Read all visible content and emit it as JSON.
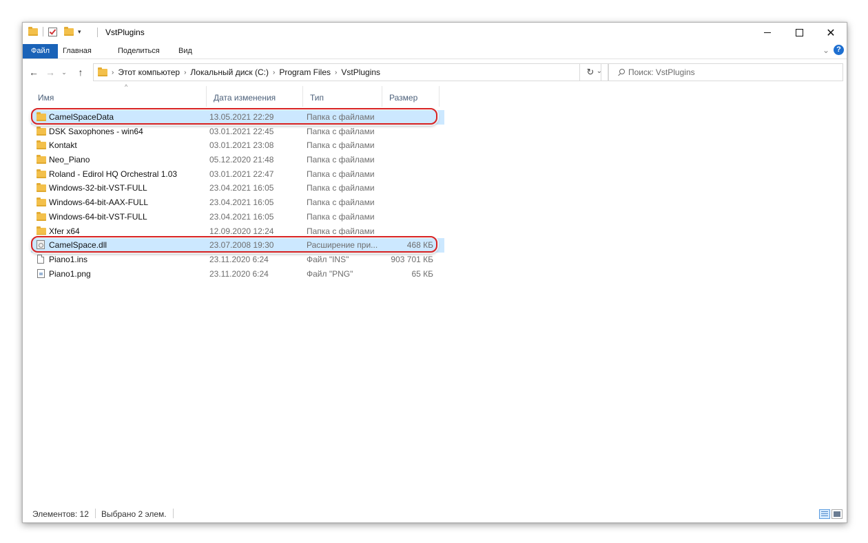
{
  "window": {
    "title": "VstPlugins"
  },
  "ribbon": {
    "tabs": [
      "Файл",
      "Главная",
      "Поделиться",
      "Вид"
    ]
  },
  "address": {
    "crumbs": [
      "Этот компьютер",
      "Локальный диск (C:)",
      "Program Files",
      "VstPlugins"
    ],
    "search_placeholder": "Поиск: VstPlugins"
  },
  "columns": {
    "name": "Имя",
    "date": "Дата изменения",
    "type": "Тип",
    "size": "Размер"
  },
  "files": [
    {
      "name": "CamelSpaceData",
      "date": "13.05.2021 22:29",
      "type": "Папка с файлами",
      "size": "",
      "icon": "folder-icon",
      "selected": true
    },
    {
      "name": "DSK Saxophones - win64",
      "date": "03.01.2021 22:45",
      "type": "Папка с файлами",
      "size": "",
      "icon": "folder-icon",
      "selected": false
    },
    {
      "name": "Kontakt",
      "date": "03.01.2021 23:08",
      "type": "Папка с файлами",
      "size": "",
      "icon": "folder-icon",
      "selected": false
    },
    {
      "name": "Neo_Piano",
      "date": "05.12.2020 21:48",
      "type": "Папка с файлами",
      "size": "",
      "icon": "folder-icon",
      "selected": false
    },
    {
      "name": "Roland - Edirol HQ Orchestral 1.03",
      "date": "03.01.2021 22:47",
      "type": "Папка с файлами",
      "size": "",
      "icon": "folder-icon",
      "selected": false
    },
    {
      "name": "Windows-32-bit-VST-FULL",
      "date": "23.04.2021 16:05",
      "type": "Папка с файлами",
      "size": "",
      "icon": "folder-icon",
      "selected": false
    },
    {
      "name": "Windows-64-bit-AAX-FULL",
      "date": "23.04.2021 16:05",
      "type": "Папка с файлами",
      "size": "",
      "icon": "folder-icon",
      "selected": false
    },
    {
      "name": "Windows-64-bit-VST-FULL",
      "date": "23.04.2021 16:05",
      "type": "Папка с файлами",
      "size": "",
      "icon": "folder-icon",
      "selected": false
    },
    {
      "name": "Xfer x64",
      "date": "12.09.2020 12:24",
      "type": "Папка с файлами",
      "size": "",
      "icon": "folder-icon",
      "selected": false
    },
    {
      "name": "CamelSpace.dll",
      "date": "23.07.2008 19:30",
      "type": "Расширение при...",
      "size": "468 КБ",
      "icon": "dll-file-icon",
      "selected": true
    },
    {
      "name": "Piano1.ins",
      "date": "23.11.2020 6:24",
      "type": "Файл \"INS\"",
      "size": "903 701 КБ",
      "icon": "file-icon",
      "selected": false
    },
    {
      "name": "Piano1.png",
      "date": "23.11.2020 6:24",
      "type": "Файл \"PNG\"",
      "size": "65 КБ",
      "icon": "image-file-icon",
      "selected": false
    }
  ],
  "status": {
    "count": "Элементов: 12",
    "selected": "Выбрано 2 элем."
  },
  "colors": {
    "selection": "#cce8ff",
    "highlight_ring": "#d82222",
    "file_tab": "#1a63b8",
    "folder": "#f3c04b"
  }
}
